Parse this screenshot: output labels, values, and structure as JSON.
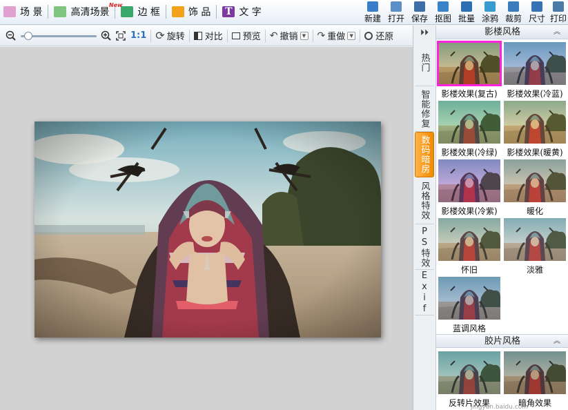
{
  "topbar": {
    "tabs": [
      {
        "label": "场 景",
        "icon": "scene-icon",
        "color": "#e0a0d0"
      },
      {
        "label": "高清场景",
        "icon": "hd-scene-icon",
        "color": "#7fc47f",
        "badge": "New"
      },
      {
        "label": "边 框",
        "icon": "frame-icon",
        "color": "#3aa86b"
      },
      {
        "label": "饰 品",
        "icon": "accessory-icon",
        "color": "#f2a31b"
      },
      {
        "label": "文 字",
        "icon": "text-icon",
        "color": "#7c3aa0"
      }
    ],
    "actions": [
      {
        "label": "新建",
        "icon": "new-file-icon",
        "color": "#3b7dc8"
      },
      {
        "label": "打开",
        "icon": "open-folder-icon",
        "color": "#5b8fc8"
      },
      {
        "label": "保存",
        "icon": "save-icon",
        "color": "#3d6ea8"
      },
      {
        "label": "抠图",
        "icon": "cutout-icon",
        "color": "#3b83c8"
      },
      {
        "label": "批量",
        "icon": "batch-icon",
        "color": "#2e6fb3"
      },
      {
        "label": "涂鸦",
        "icon": "doodle-icon",
        "color": "#3a9bd0"
      },
      {
        "label": "裁剪",
        "icon": "crop-icon",
        "color": "#3a7dbd"
      },
      {
        "label": "尺寸",
        "icon": "resize-icon",
        "color": "#3573b5"
      },
      {
        "label": "打印",
        "icon": "print-icon",
        "color": "#4a7aa8"
      }
    ]
  },
  "toolbar2": {
    "zoom_ratio_label": "1:1",
    "rotate": "旋转",
    "compare": "对比",
    "preview": "预览",
    "undo": "撤销",
    "redo": "重做",
    "restore": "还原",
    "zoom_level": 0.05
  },
  "side_tabs": [
    {
      "label": "热门",
      "active": false
    },
    {
      "label": "智能修复",
      "active": false
    },
    {
      "label": "数码暗房",
      "active": true
    },
    {
      "label": "风格特效",
      "active": false
    },
    {
      "label": "PS特效",
      "active": false
    },
    {
      "label": "Exif",
      "active": false
    }
  ],
  "panel": {
    "section1_title": "影楼风格",
    "section2_title": "胶片风格",
    "collapse_glyph": "︽",
    "section1_items": [
      {
        "label": "影楼效果(复古)",
        "tint": "#c9a24a",
        "selected": true
      },
      {
        "label": "影楼效果(冷蓝)",
        "tint": "#7f9ad8",
        "selected": false
      },
      {
        "label": "影楼效果(冷绿)",
        "tint": "#8fd08a",
        "selected": false
      },
      {
        "label": "影楼效果(暖黄)",
        "tint": "#e3c26a",
        "selected": false
      },
      {
        "label": "影楼效果(冷紫)",
        "tint": "#c07ae0",
        "selected": false
      },
      {
        "label": "暖化",
        "tint": "#d9b089",
        "selected": false
      },
      {
        "label": "怀旧",
        "tint": "#cfc09a",
        "selected": false
      },
      {
        "label": "淡雅",
        "tint": "#c9c9c0",
        "selected": false
      },
      {
        "label": "蓝调风格",
        "tint": "#8aa0c8",
        "selected": false
      }
    ],
    "section2_items": [
      {
        "label": "反转片效果",
        "tint": "#7fb0a0"
      },
      {
        "label": "暗角效果",
        "tint": "#9a8a70"
      }
    ]
  },
  "watermark": "jingyan.baidu.com"
}
